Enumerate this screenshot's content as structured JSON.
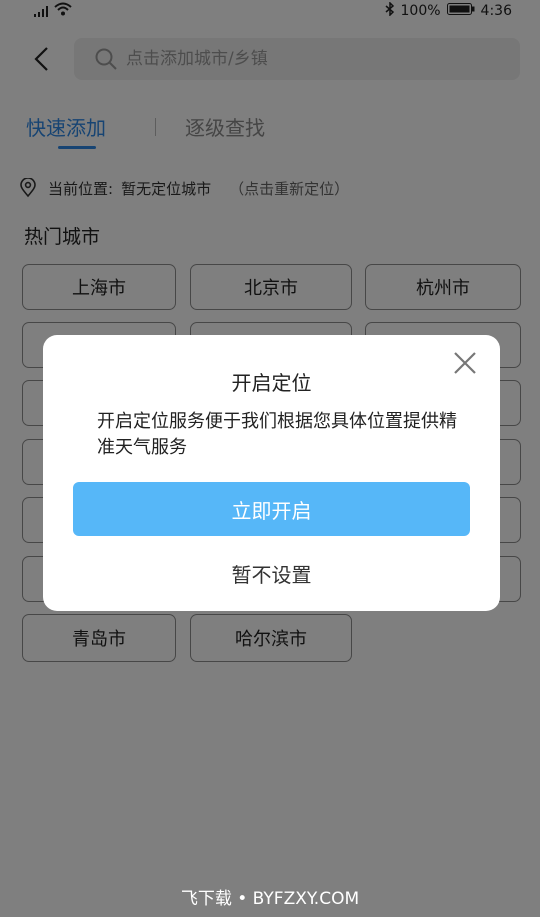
{
  "status_bar": {
    "battery": "100%",
    "time": "4:36",
    "icons": [
      "signal-icon",
      "wifi-icon",
      "bluetooth-icon",
      "battery-icon"
    ]
  },
  "search": {
    "placeholder": "点击添加城市/乡镇",
    "value": ""
  },
  "tabs": [
    {
      "label": "快速添加",
      "active": true
    },
    {
      "label": "逐级查找",
      "active": false
    }
  ],
  "location": {
    "label": "当前位置:",
    "value": "暂无定位城市",
    "action": "（点击重新定位）"
  },
  "hot_cities": {
    "title": "热门城市",
    "cities": [
      "上海市",
      "北京市",
      "杭州市",
      "",
      "",
      "",
      "",
      "",
      "",
      "",
      "",
      "",
      "",
      "",
      "",
      "",
      "",
      "",
      "青岛市",
      "哈尔滨市"
    ]
  },
  "dialog": {
    "title": "开启定位",
    "message": "开启定位服务便于我们根据您具体位置提供精准天气服务",
    "primary_label": "立即开启",
    "secondary_label": "暂不设置"
  },
  "watermark": "飞下载 • BYFZXY.COM",
  "colors": {
    "accent": "#2f89e6",
    "primary_button": "#56b7f8",
    "overlay": "rgba(0,0,0,0.5)"
  }
}
